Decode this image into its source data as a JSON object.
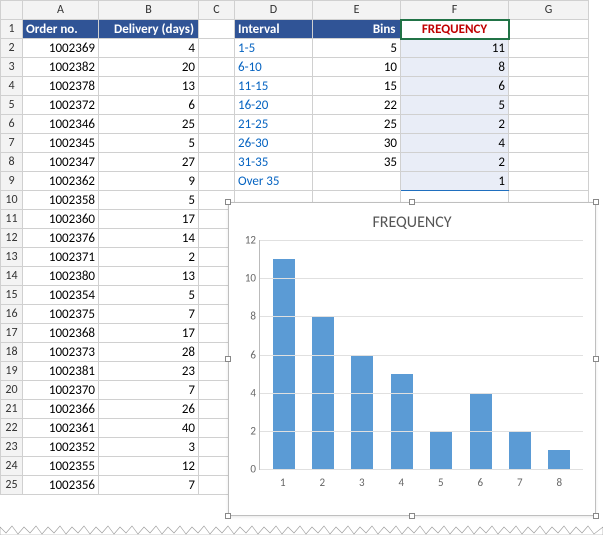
{
  "columns": [
    "A",
    "B",
    "C",
    "D",
    "E",
    "F",
    "G"
  ],
  "headers": {
    "A": "Order no.",
    "B": "Delivery (days)",
    "D": "Interval",
    "E": "Bins",
    "F": "FREQUENCY"
  },
  "orders": [
    {
      "no": "1002369",
      "days": 4
    },
    {
      "no": "1002382",
      "days": 20
    },
    {
      "no": "1002378",
      "days": 13
    },
    {
      "no": "1002372",
      "days": 6
    },
    {
      "no": "1002346",
      "days": 25
    },
    {
      "no": "1002345",
      "days": 5
    },
    {
      "no": "1002347",
      "days": 27
    },
    {
      "no": "1002362",
      "days": 9
    },
    {
      "no": "1002358",
      "days": 5
    },
    {
      "no": "1002360",
      "days": 17
    },
    {
      "no": "1002376",
      "days": 14
    },
    {
      "no": "1002371",
      "days": 2
    },
    {
      "no": "1002380",
      "days": 13
    },
    {
      "no": "1002354",
      "days": 5
    },
    {
      "no": "1002375",
      "days": 7
    },
    {
      "no": "1002368",
      "days": 17
    },
    {
      "no": "1002373",
      "days": 28
    },
    {
      "no": "1002381",
      "days": 23
    },
    {
      "no": "1002370",
      "days": 7
    },
    {
      "no": "1002366",
      "days": 26
    },
    {
      "no": "1002361",
      "days": 40
    },
    {
      "no": "1002352",
      "days": 3
    },
    {
      "no": "1002355",
      "days": 12
    },
    {
      "no": "1002356",
      "days": 7
    }
  ],
  "freq_table": [
    {
      "interval": "1-5",
      "bin": 5,
      "freq": 11
    },
    {
      "interval": "6-10",
      "bin": 10,
      "freq": 8
    },
    {
      "interval": "11-15",
      "bin": 15,
      "freq": 6
    },
    {
      "interval": "16-20",
      "bin": 22,
      "freq": 5
    },
    {
      "interval": "21-25",
      "bin": 25,
      "freq": 2
    },
    {
      "interval": "26-30",
      "bin": 30,
      "freq": 4
    },
    {
      "interval": "31-35",
      "bin": 35,
      "freq": 2
    },
    {
      "interval": "Over 35",
      "bin": "",
      "freq": 1
    }
  ],
  "chart_data": {
    "type": "bar",
    "title": "FREQUENCY",
    "categories": [
      "1",
      "2",
      "3",
      "4",
      "5",
      "6",
      "7",
      "8"
    ],
    "values": [
      11,
      8,
      6,
      5,
      2,
      4,
      2,
      1
    ],
    "ylim": [
      0,
      12
    ],
    "yticks": [
      0,
      2,
      4,
      6,
      8,
      10,
      12
    ],
    "grid": true
  }
}
